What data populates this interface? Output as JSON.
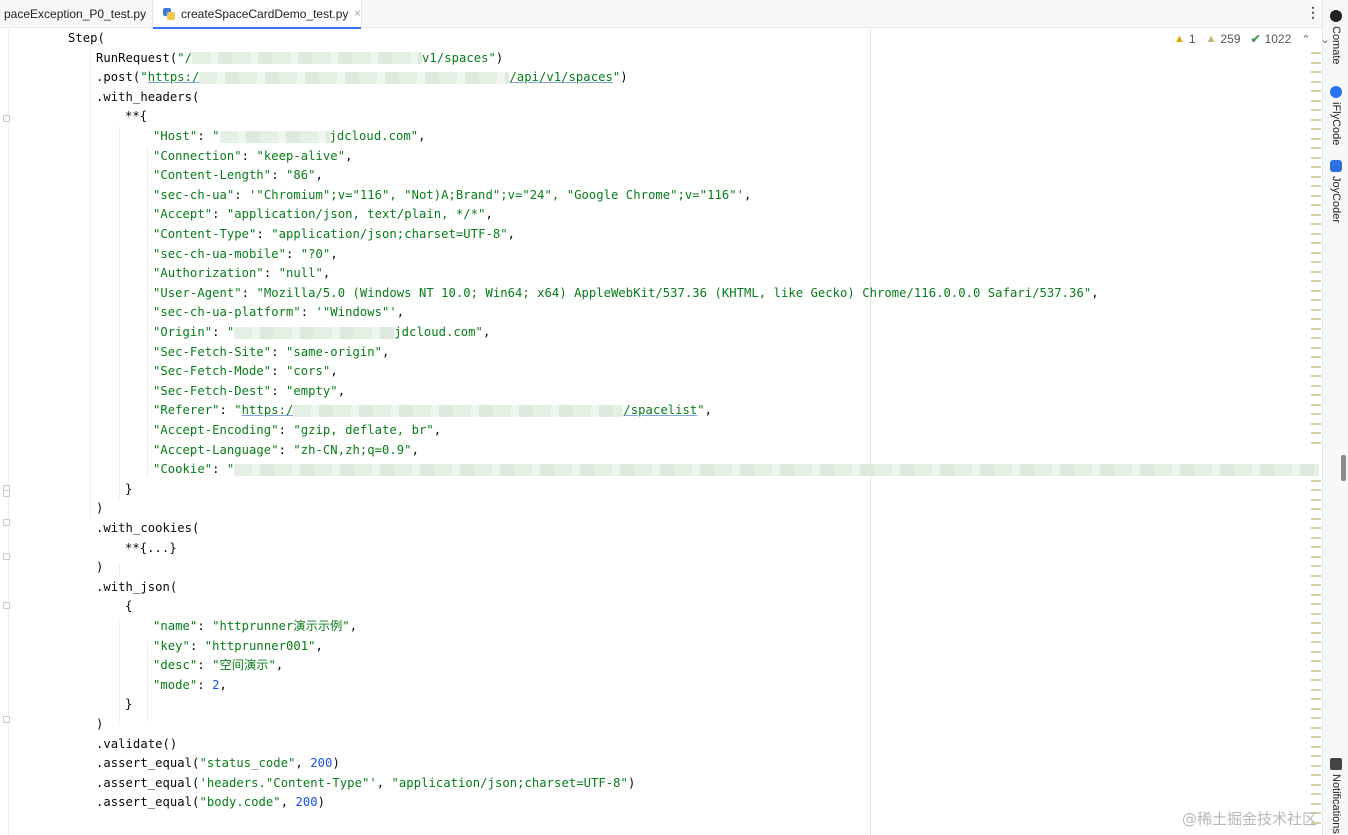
{
  "tabs": [
    {
      "label": "paceException_P0_test.py",
      "close": "×"
    },
    {
      "label": "createSpaceCardDemo_test.py",
      "close": "×"
    }
  ],
  "tab_overflow": "⋮",
  "right_tools": [
    {
      "label": "Comate",
      "icon": "comate-icon",
      "color": "#222222"
    },
    {
      "label": "iFlyCode",
      "icon": "iflycode-icon",
      "color": "#2b73f0"
    },
    {
      "label": "JoyCoder",
      "icon": "joycoder-icon",
      "color": "#2f6fe0"
    },
    {
      "label": "Notifications",
      "icon": "bell-icon",
      "color": "#444444"
    }
  ],
  "inspections": {
    "warnings": "1",
    "weak_warnings": "259",
    "typos": "1022",
    "warning_icon": "▲",
    "weak_icon": "▲",
    "typo_icon": "✔",
    "up": "⌃",
    "down": "⌄"
  },
  "code_lines": [
    [
      {
        "t": "Step("
      }
    ],
    [
      {
        "t": "RunRequest("
      },
      {
        "t": "\"/",
        "c": "s"
      },
      {
        "blur": 230
      },
      {
        "t": "v1/spaces\"",
        "c": "s"
      },
      {
        "t": ")"
      }
    ],
    [
      {
        "t": ".post("
      },
      {
        "t": "\"",
        "c": "s"
      },
      {
        "t": "https:/",
        "c": "s u"
      },
      {
        "blur": 310
      },
      {
        "t": "/api/v1/spaces",
        "c": "s u"
      },
      {
        "t": "\"",
        "c": "s"
      },
      {
        "t": ")"
      }
    ],
    [
      {
        "t": ".with_headers("
      }
    ],
    [
      {
        "t": "**{"
      }
    ],
    [
      {
        "t": "\"Host\"",
        "c": "s"
      },
      {
        "t": ": "
      },
      {
        "t": "\"",
        "c": "s"
      },
      {
        "blur": 110
      },
      {
        "t": "jdcloud.com\"",
        "c": "s"
      },
      {
        "t": ","
      }
    ],
    [
      {
        "t": "\"Connection\"",
        "c": "s"
      },
      {
        "t": ": "
      },
      {
        "t": "\"keep-alive\"",
        "c": "s"
      },
      {
        "t": ","
      }
    ],
    [
      {
        "t": "\"Content-Length\"",
        "c": "s"
      },
      {
        "t": ": "
      },
      {
        "t": "\"86\"",
        "c": "s"
      },
      {
        "t": ","
      }
    ],
    [
      {
        "t": "\"sec-ch-ua\"",
        "c": "s"
      },
      {
        "t": ": "
      },
      {
        "t": "'\"Chromium\";v=\"116\", \"Not)A;Brand\";v=\"24\", \"Google Chrome\";v=\"116\"'",
        "c": "s"
      },
      {
        "t": ","
      }
    ],
    [
      {
        "t": "\"Accept\"",
        "c": "s"
      },
      {
        "t": ": "
      },
      {
        "t": "\"application/json, text/plain, */*\"",
        "c": "s"
      },
      {
        "t": ","
      }
    ],
    [
      {
        "t": "\"Content-Type\"",
        "c": "s"
      },
      {
        "t": ": "
      },
      {
        "t": "\"application/json;charset=UTF-8\"",
        "c": "s"
      },
      {
        "t": ","
      }
    ],
    [
      {
        "t": "\"sec-ch-ua-mobile\"",
        "c": "s"
      },
      {
        "t": ": "
      },
      {
        "t": "\"?0\"",
        "c": "s"
      },
      {
        "t": ","
      }
    ],
    [
      {
        "t": "\"Authorization\"",
        "c": "s"
      },
      {
        "t": ": "
      },
      {
        "t": "\"null\"",
        "c": "s"
      },
      {
        "t": ","
      }
    ],
    [
      {
        "t": "\"User-Agent\"",
        "c": "s"
      },
      {
        "t": ": "
      },
      {
        "t": "\"Mozilla/5.0 (Windows NT 10.0; Win64; x64) AppleWebKit/537.36 (KHTML, like Gecko) Chrome/116.0.0.0 Safari/537.36\"",
        "c": "s"
      },
      {
        "t": ","
      }
    ],
    [
      {
        "t": "\"sec-ch-ua-platform\"",
        "c": "s"
      },
      {
        "t": ": "
      },
      {
        "t": "'\"Windows\"'",
        "c": "s"
      },
      {
        "t": ","
      }
    ],
    [
      {
        "t": "\"Origin\"",
        "c": "s"
      },
      {
        "t": ": "
      },
      {
        "t": "\"",
        "c": "s"
      },
      {
        "blur": 160
      },
      {
        "t": "jdcloud.com\"",
        "c": "s"
      },
      {
        "t": ","
      }
    ],
    [
      {
        "t": "\"Sec-Fetch-Site\"",
        "c": "s"
      },
      {
        "t": ": "
      },
      {
        "t": "\"same-origin\"",
        "c": "s"
      },
      {
        "t": ","
      }
    ],
    [
      {
        "t": "\"Sec-Fetch-Mode\"",
        "c": "s"
      },
      {
        "t": ": "
      },
      {
        "t": "\"cors\"",
        "c": "s"
      },
      {
        "t": ","
      }
    ],
    [
      {
        "t": "\"Sec-Fetch-Dest\"",
        "c": "s"
      },
      {
        "t": ": "
      },
      {
        "t": "\"empty\"",
        "c": "s"
      },
      {
        "t": ","
      }
    ],
    [
      {
        "t": "\"Referer\"",
        "c": "s"
      },
      {
        "t": ": "
      },
      {
        "t": "\"",
        "c": "s"
      },
      {
        "t": "https:/",
        "c": "s u"
      },
      {
        "blur": 330
      },
      {
        "t": "/spacelist",
        "c": "s u"
      },
      {
        "t": "\"",
        "c": "s"
      },
      {
        "t": ","
      }
    ],
    [
      {
        "t": "\"Accept-Encoding\"",
        "c": "s"
      },
      {
        "t": ": "
      },
      {
        "t": "\"gzip, deflate, br\"",
        "c": "s"
      },
      {
        "t": ","
      }
    ],
    [
      {
        "t": "\"Accept-Language\"",
        "c": "s"
      },
      {
        "t": ": "
      },
      {
        "t": "\"zh-CN,zh;q=0.9\"",
        "c": "s"
      },
      {
        "t": ","
      }
    ],
    [
      {
        "t": "\"Cookie\"",
        "c": "s"
      },
      {
        "t": ": "
      },
      {
        "t": "\"",
        "c": "s"
      },
      {
        "blur": 1085
      }
    ],
    [
      {
        "t": "}"
      }
    ],
    [
      {
        "t": ")"
      }
    ],
    [
      {
        "t": ".with_cookies("
      }
    ],
    [
      {
        "t": "**{...}"
      }
    ],
    [
      {
        "t": ")"
      }
    ],
    [
      {
        "t": ".with_json("
      }
    ],
    [
      {
        "t": "{"
      }
    ],
    [
      {
        "t": "\"name\"",
        "c": "s"
      },
      {
        "t": ": "
      },
      {
        "t": "\"httprunner演示示例\"",
        "c": "s"
      },
      {
        "t": ","
      }
    ],
    [
      {
        "t": "\"key\"",
        "c": "s"
      },
      {
        "t": ": "
      },
      {
        "t": "\"httprunner001\"",
        "c": "s"
      },
      {
        "t": ","
      }
    ],
    [
      {
        "t": "\"desc\"",
        "c": "s"
      },
      {
        "t": ": "
      },
      {
        "t": "\"空间演示\"",
        "c": "s"
      },
      {
        "t": ","
      }
    ],
    [
      {
        "t": "\"mode\"",
        "c": "s"
      },
      {
        "t": ": "
      },
      {
        "t": "2",
        "c": "n"
      },
      {
        "t": ","
      }
    ],
    [
      {
        "t": "}"
      }
    ],
    [
      {
        "t": ")"
      }
    ],
    [
      {
        "t": ".validate()"
      }
    ],
    [
      {
        "t": ".assert_equal("
      },
      {
        "t": "\"status_code\"",
        "c": "s"
      },
      {
        "t": ", "
      },
      {
        "t": "200",
        "c": "n"
      },
      {
        "t": ")"
      }
    ],
    [
      {
        "t": ".assert_equal("
      },
      {
        "t": "'headers.\"Content-Type\"'",
        "c": "s"
      },
      {
        "t": ", "
      },
      {
        "t": "\"application/json;charset=UTF-8\"",
        "c": "s"
      },
      {
        "t": ")"
      }
    ],
    [
      {
        "t": ".assert_equal("
      },
      {
        "t": "\"body.code\"",
        "c": "s"
      },
      {
        "t": ", "
      },
      {
        "t": "200",
        "c": "n"
      },
      {
        "t": ")"
      }
    ]
  ],
  "watermark": "@稀土掘金技术社区"
}
